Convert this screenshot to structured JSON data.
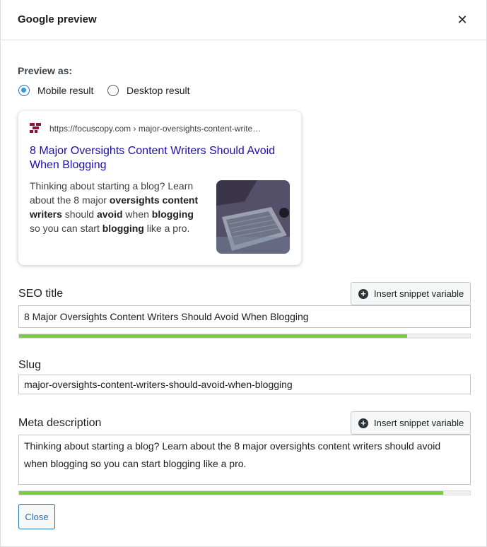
{
  "modal": {
    "title": "Google preview",
    "close_icon_glyph": "✕"
  },
  "preview_as": {
    "label": "Preview as:",
    "options": [
      {
        "label": "Mobile result",
        "selected": true
      },
      {
        "label": "Desktop result",
        "selected": false
      }
    ]
  },
  "serp": {
    "url": "https://focuscopy.com › major-oversights-content-write…",
    "title": "8 Major Oversights Content Writers Should Avoid When Blogging",
    "description_parts": [
      {
        "text": "Thinking about starting a blog? Learn about the 8 major ",
        "bold": false
      },
      {
        "text": "oversights content writers",
        "bold": true
      },
      {
        "text": " should ",
        "bold": false
      },
      {
        "text": "avoid",
        "bold": true
      },
      {
        "text": " when ",
        "bold": false
      },
      {
        "text": "blogging",
        "bold": true
      },
      {
        "text": " so you can start ",
        "bold": false
      },
      {
        "text": "blogging",
        "bold": true
      },
      {
        "text": " like a pro.",
        "bold": false
      }
    ],
    "favicon_color": "#8b1538",
    "title_color": "#1a0dab"
  },
  "seo_title": {
    "label": "SEO title",
    "snippet_button": "Insert snippet variable",
    "value": "8 Major Oversights Content Writers Should Avoid When Blogging",
    "progress": 0.86,
    "progress_color": "#7ad03a"
  },
  "slug": {
    "label": "Slug",
    "value": "major-oversights-content-writers-should-avoid-when-blogging"
  },
  "meta_description": {
    "label": "Meta description",
    "snippet_button": "Insert snippet variable",
    "value": "Thinking about starting a blog? Learn about the 8 major oversights content writers should avoid when blogging so you can start blogging like a pro.",
    "progress": 0.94,
    "progress_color": "#7ad03a"
  },
  "footer": {
    "close_label": "Close"
  }
}
